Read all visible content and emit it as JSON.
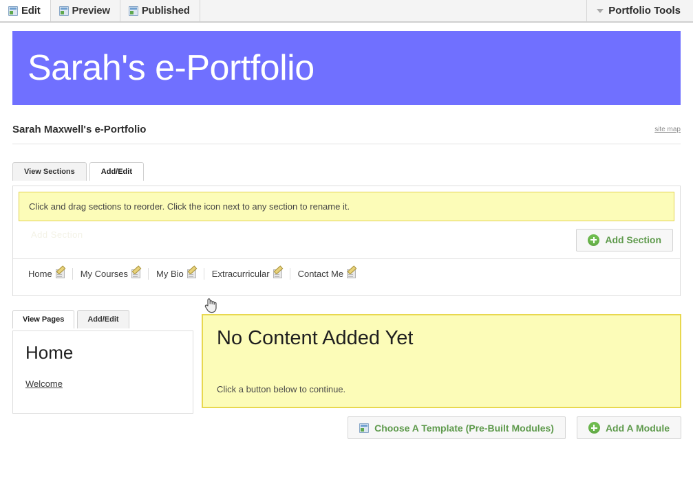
{
  "topbar": {
    "tabs": [
      {
        "label": "Edit",
        "icon": "window-icon",
        "active": true
      },
      {
        "label": "Preview",
        "icon": "window-icon",
        "active": false
      },
      {
        "label": "Published",
        "icon": "window-icon",
        "active": false
      }
    ],
    "tools_label": "Portfolio Tools",
    "tools_icon": "chevron-down-icon"
  },
  "banner": {
    "title": "Sarah's e-Portfolio",
    "color": "#7070ff"
  },
  "subbar": {
    "title": "Sarah Maxwell's e-Portfolio",
    "site_map_label": "site map"
  },
  "section_tabs": [
    {
      "label": "View Sections",
      "active": false
    },
    {
      "label": "Add/Edit",
      "active": true
    }
  ],
  "notice": {
    "text": "Click and drag sections to reorder. Click the icon next to any section to rename it.",
    "bg": "#fcfcb8",
    "border": "#e3d24d"
  },
  "add_section_button": {
    "label": "Add Section",
    "icon": "plus-circle-icon",
    "color": "#5e9a4c"
  },
  "ghost_text": "Add Section",
  "sections": [
    {
      "label": "Home",
      "icon": "edit-icon"
    },
    {
      "label": "My Courses",
      "icon": "edit-icon"
    },
    {
      "label": "My Bio",
      "icon": "edit-icon"
    },
    {
      "label": "Extracurricular",
      "icon": "edit-icon"
    },
    {
      "label": "Contact Me",
      "icon": "edit-icon"
    }
  ],
  "page_tabs": [
    {
      "label": "View Pages",
      "active": true
    },
    {
      "label": "Add/Edit",
      "active": false
    }
  ],
  "pages_panel": {
    "title": "Home",
    "items": [
      {
        "label": "Welcome"
      }
    ]
  },
  "content_panel": {
    "title": "No Content Added Yet",
    "subtitle": "Click a button below to continue.",
    "bg": "#fcfcb8",
    "border": "#e8d84f"
  },
  "bottom_buttons": [
    {
      "label": "Choose A Template (Pre-Built Modules)",
      "icon": "window-icon",
      "color": "#5e9a4c"
    },
    {
      "label": "Add A Module",
      "icon": "plus-circle-icon",
      "color": "#5e9a4c"
    }
  ],
  "cursor": {
    "type": "pointer-hand-cursor"
  }
}
